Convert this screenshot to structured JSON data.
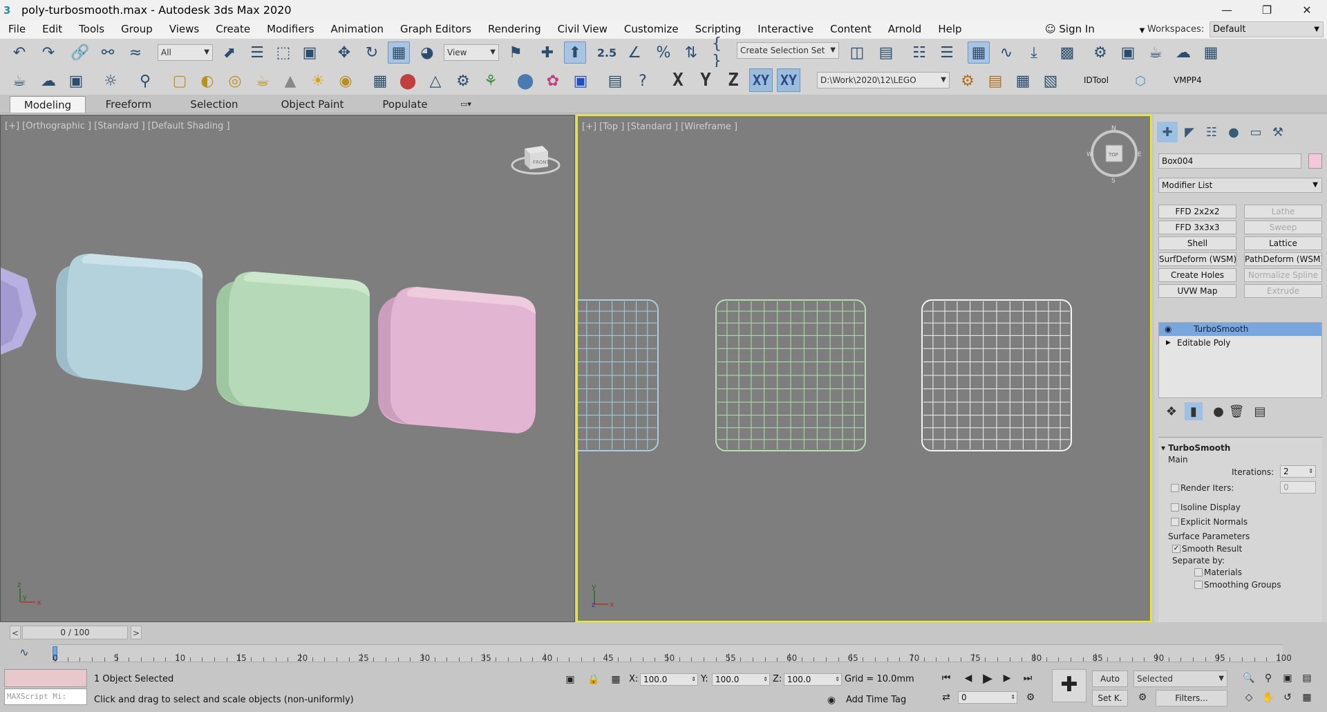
{
  "window": {
    "title": "poly-turbosmooth.max - Autodesk 3ds Max 2020",
    "app_icon": "3"
  },
  "menu": [
    "File",
    "Edit",
    "Tools",
    "Group",
    "Views",
    "Create",
    "Modifiers",
    "Animation",
    "Graph Editors",
    "Rendering",
    "Civil View",
    "Customize",
    "Scripting",
    "Interactive",
    "Content",
    "Arnold",
    "Help"
  ],
  "account": {
    "sign_in": "Sign In",
    "workspaces_label": "Workspaces:",
    "workspace_value": "Default"
  },
  "toolbar1": {
    "filter_value": "All",
    "refcoord_value": "View",
    "angle_snap_label": "2.5",
    "selection_set_placeholder": "Create Selection Set"
  },
  "toolbar2": {
    "axis_x": "X",
    "axis_y": "Y",
    "axis_z": "Z",
    "axis_xy": "XY",
    "axis_xy2": "XY",
    "path_value": "D:\\Work\\2020\\12\\LEGO",
    "idtool": "IDTool",
    "vmpp": "VMPP4"
  },
  "ribbon_tabs": [
    "Modeling",
    "Freeform",
    "Selection",
    "Object Paint",
    "Populate"
  ],
  "viewport_left": {
    "label": "[+] [Orthographic ] [Standard ] [Default Shading ]",
    "viewcube_label": "FRONT"
  },
  "viewport_right": {
    "label": "[+] [Top ] [Standard ] [Wireframe ]",
    "viewcube_label": "TOP",
    "compass": {
      "n": "N",
      "s": "S",
      "w": "W",
      "e": "E"
    }
  },
  "command_panel": {
    "object_name": "Box004",
    "object_color": "#f4c8dc",
    "modifier_list": "Modifier List",
    "modifier_buttons": [
      {
        "label": "FFD 2x2x2",
        "disabled": false
      },
      {
        "label": "Lathe",
        "disabled": true
      },
      {
        "label": "FFD 3x3x3",
        "disabled": false
      },
      {
        "label": "Sweep",
        "disabled": true
      },
      {
        "label": "Shell",
        "disabled": false
      },
      {
        "label": "Lattice",
        "disabled": false
      },
      {
        "label": "SurfDeform (WSM)",
        "disabled": false
      },
      {
        "label": "PathDeform (WSM)",
        "disabled": false
      },
      {
        "label": "Create Holes",
        "disabled": false
      },
      {
        "label": "Normalize Spline",
        "disabled": true
      },
      {
        "label": "UVW Map",
        "disabled": false
      },
      {
        "label": "Extrude",
        "disabled": true
      }
    ],
    "stack": [
      {
        "label": "TurboSmooth",
        "selected": true
      },
      {
        "label": "Editable Poly",
        "selected": false
      }
    ],
    "rollout": {
      "title": "TurboSmooth",
      "main_label": "Main",
      "iterations_label": "Iterations:",
      "iterations_value": "2",
      "render_iters_label": "Render Iters:",
      "render_iters_value": "0",
      "isoline_label": "Isoline Display",
      "explicit_normals_label": "Explicit Normals",
      "surface_params_label": "Surface Parameters",
      "smooth_result_label": "Smooth Result",
      "smooth_result_checked": true,
      "separate_by_label": "Separate by:",
      "materials_label": "Materials",
      "smoothing_groups_label": "Smoothing Groups"
    }
  },
  "timeline": {
    "slider_value": "0 / 100",
    "ticks": [
      "0",
      "5",
      "10",
      "15",
      "20",
      "25",
      "30",
      "35",
      "40",
      "45",
      "50",
      "55",
      "60",
      "65",
      "70",
      "75",
      "80",
      "85",
      "90",
      "95",
      "100"
    ]
  },
  "status": {
    "maxscript_placeholder": "MAXScript Mi:",
    "selection_text": "1 Object Selected",
    "prompt_text": "Click and drag to select and scale objects (non-uniformly)",
    "x_label": "X:",
    "x_value": "100.0",
    "y_label": "Y:",
    "y_value": "100.0",
    "z_label": "Z:",
    "z_value": "100.0",
    "grid_text": "Grid = 10.0mm",
    "add_time_tag": "Add Time Tag",
    "auto_label": "Auto",
    "selected_dropdown": "Selected",
    "setkey_label": "Set K.",
    "filters_label": "Filters...",
    "frame_value": "0"
  },
  "colors": {
    "cube_blue": "#b4d2dc",
    "cube_green": "#b6dab8",
    "cube_pink": "#e2b6d2",
    "cube_purple": "#b8b0e0",
    "viewport_bg": "#7e7e7e",
    "active_border": "#f0f000"
  }
}
